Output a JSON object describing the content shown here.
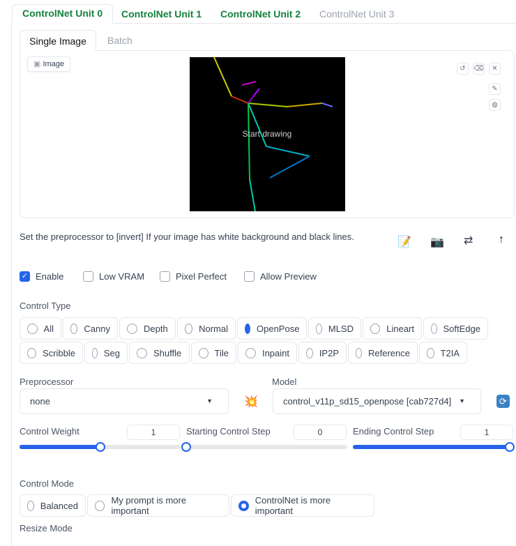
{
  "unit_tabs": [
    "ControlNet Unit 0",
    "ControlNet Unit 1",
    "ControlNet Unit 2",
    "ControlNet Unit 3"
  ],
  "image_tabs": [
    "Single Image",
    "Batch"
  ],
  "image_label": "Image",
  "canvas_hint": "Start drawing",
  "hint_text": "Set the preprocessor to [invert] If your image has white background and black lines.",
  "checkboxes": [
    {
      "label": "Enable",
      "checked": true
    },
    {
      "label": "Low VRAM",
      "checked": false
    },
    {
      "label": "Pixel Perfect",
      "checked": false
    },
    {
      "label": "Allow Preview",
      "checked": false
    }
  ],
  "control_type": {
    "label": "Control Type",
    "options": [
      "All",
      "Canny",
      "Depth",
      "Normal",
      "OpenPose",
      "MLSD",
      "Lineart",
      "SoftEdge",
      "Scribble",
      "Seg",
      "Shuffle",
      "Tile",
      "Inpaint",
      "IP2P",
      "Reference",
      "T2IA"
    ],
    "selected": "OpenPose"
  },
  "preprocessor": {
    "label": "Preprocessor",
    "value": "none"
  },
  "model": {
    "label": "Model",
    "value": "control_v11p_sd15_openpose [cab727d4]"
  },
  "sliders": [
    {
      "label": "Control Weight",
      "value": "1",
      "fraction": 0.5
    },
    {
      "label": "Starting Control Step",
      "value": "0",
      "fraction": 0
    },
    {
      "label": "Ending Control Step",
      "value": "1",
      "fraction": 1
    }
  ],
  "control_mode": {
    "label": "Control Mode",
    "options": [
      "Balanced",
      "My prompt is more important",
      "ControlNet is more important"
    ],
    "selected": "ControlNet is more important"
  },
  "resize_mode": {
    "label": "Resize Mode"
  },
  "colors": {
    "accent": "#2563eb",
    "tab_green": "#15803d"
  }
}
